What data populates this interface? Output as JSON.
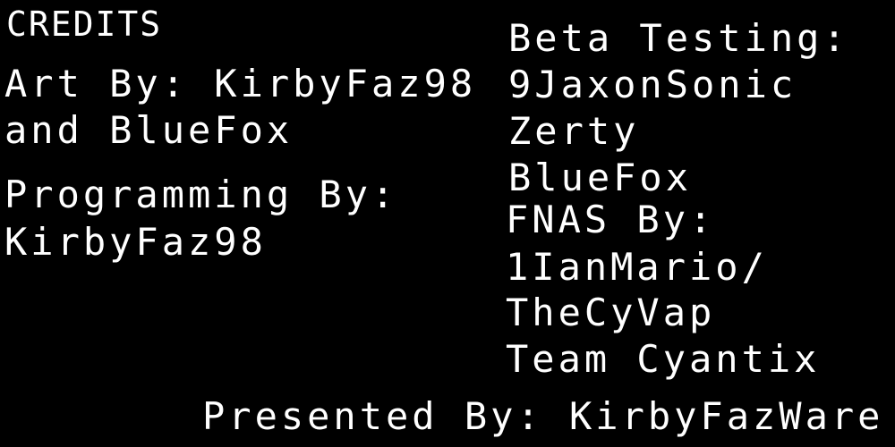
{
  "screen": {
    "background_color": "#000000",
    "text_color": "#ffffff"
  },
  "credits": {
    "heading": "CREDITS",
    "art": {
      "line1": "Art By: KirbyFaz98",
      "line2": "and BlueFox"
    },
    "programming": {
      "line1": "Programming By:",
      "line2": "KirbyFaz98"
    },
    "beta_testing": {
      "title": "Beta Testing:",
      "names": [
        "9JaxonSonic",
        "Zerty",
        "BlueFox"
      ]
    },
    "fnas": {
      "title": "FNAS By:",
      "lines": [
        "1IanMario/",
        "TheCyVap",
        "Team Cyantix"
      ]
    },
    "presented": "Presented By: KirbyFazWare"
  }
}
